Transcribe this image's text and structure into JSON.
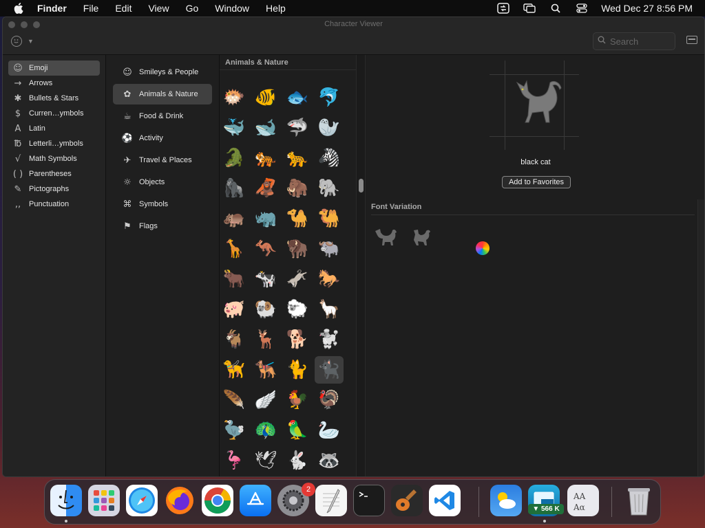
{
  "menubar": {
    "app_name": "Finder",
    "items": [
      "File",
      "Edit",
      "View",
      "Go",
      "Window",
      "Help"
    ],
    "datetime": "Wed Dec 27  8:56 PM"
  },
  "window": {
    "title": "Character Viewer",
    "search_placeholder": "Search"
  },
  "categories": [
    {
      "icon": "☺",
      "label": "Emoji",
      "selected": true
    },
    {
      "icon": "→",
      "label": "Arrows"
    },
    {
      "icon": "✱",
      "label": "Bullets & Stars"
    },
    {
      "icon": "$",
      "label": "Curren…ymbols"
    },
    {
      "icon": "A",
      "label": "Latin"
    },
    {
      "icon": "℔",
      "label": "Letterli…ymbols"
    },
    {
      "icon": "√",
      "label": "Math Symbols"
    },
    {
      "icon": "( )",
      "label": "Parentheses"
    },
    {
      "icon": "✎",
      "label": "Pictographs"
    },
    {
      "icon": ",,",
      "label": "Punctuation"
    }
  ],
  "subcategories": [
    {
      "icon": "☺",
      "label": "Smileys & People"
    },
    {
      "icon": "✿",
      "label": "Animals & Nature",
      "selected": true
    },
    {
      "icon": "☕",
      "label": "Food & Drink"
    },
    {
      "icon": "⚽",
      "label": "Activity"
    },
    {
      "icon": "✈",
      "label": "Travel & Places"
    },
    {
      "icon": "☼",
      "label": "Objects"
    },
    {
      "icon": "⌘",
      "label": "Symbols"
    },
    {
      "icon": "⚑",
      "label": "Flags"
    }
  ],
  "grid": {
    "header": "Animals & Nature",
    "rows": [
      [
        "🐡",
        "🐠",
        "🐟",
        "🐬"
      ],
      [
        "🐳",
        "🐋",
        "🦈",
        "🦭"
      ],
      [
        "🐊",
        "🐅",
        "🐆",
        "🦓"
      ],
      [
        "🦍",
        "🦧",
        "🦣",
        "🐘"
      ],
      [
        "🦛",
        "🦏",
        "🐪",
        "🐫"
      ],
      [
        "🦒",
        "🦘",
        "🦬",
        "🐃"
      ],
      [
        "🐂",
        "🐄",
        "🫏",
        "🐎"
      ],
      [
        "🐖",
        "🐏",
        "🐑",
        "🦙"
      ],
      [
        "🐐",
        "🦌",
        "🐕",
        "🐩"
      ],
      [
        "🦮",
        "🐕‍🦺",
        "🐈",
        "🐈‍⬛"
      ],
      [
        "🪶",
        "🪽",
        "🐓",
        "🦃"
      ],
      [
        "🦤",
        "🦚",
        "🦜",
        "🦢"
      ],
      [
        "🦩",
        "🕊",
        "🐇",
        "🦝"
      ]
    ],
    "selected": {
      "row": 9,
      "col": 3
    }
  },
  "detail": {
    "char_name": "black cat",
    "favorites_label": "Add to Favorites",
    "font_variation_header": "Font Variation"
  },
  "dock": {
    "apps": [
      "finder-icon",
      "launchpad-icon",
      "safari-icon",
      "firefox-icon",
      "chrome-icon",
      "app-store-icon",
      "system-settings-icon",
      "textedit-icon",
      "terminal-icon",
      "garageband-icon",
      "vscode-icon",
      "weather-icon",
      "screens-icon",
      "font-book-icon",
      "trash-icon"
    ],
    "settings_badge": "2",
    "net_badge": "▼ 566 K"
  }
}
